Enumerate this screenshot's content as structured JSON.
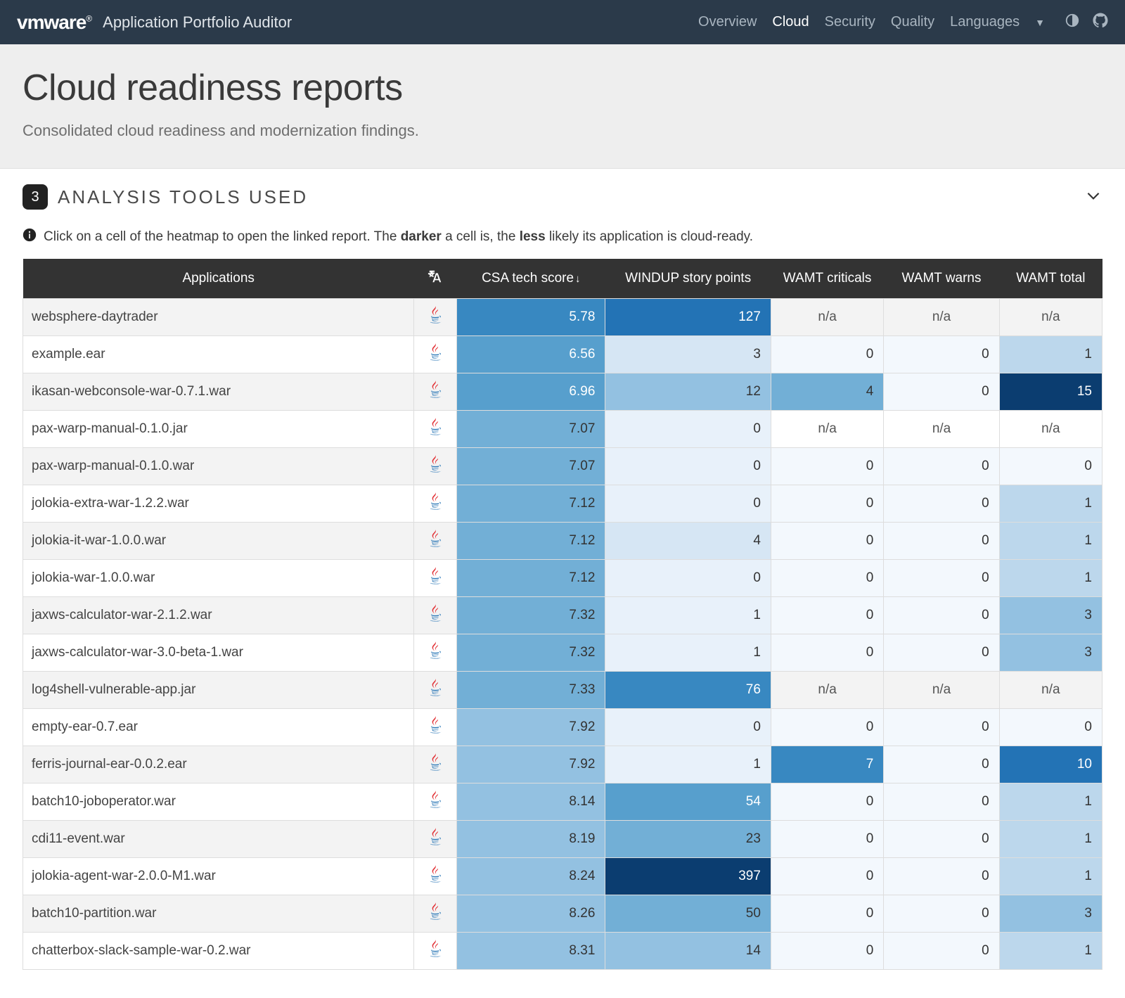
{
  "navbar": {
    "brand": "vmware",
    "app_title": "Application Portfolio Auditor",
    "links": {
      "overview": "Overview",
      "cloud": "Cloud",
      "security": "Security",
      "quality": "Quality",
      "languages": "Languages"
    }
  },
  "header": {
    "title": "Cloud readiness reports",
    "subtitle": "Consolidated cloud readiness and modernization findings."
  },
  "tools_section": {
    "count": "3",
    "label": "ANALYSIS TOOLS USED"
  },
  "info": {
    "pre": "Click on a cell of the heatmap to open the linked report. The ",
    "b1": "darker",
    "mid": " a cell is, the ",
    "b2": "less",
    "post": " likely its application is cloud-ready."
  },
  "columns": {
    "app": "Applications",
    "csa": "CSA tech score",
    "windup": "WINDUP story points",
    "wcrit": "WAMT criticals",
    "wwarn": "WAMT warns",
    "wtotal": "WAMT total"
  },
  "cell_colors": {
    "na": "#ffffff",
    "s0": "#f3f8fd",
    "s1": "#e8f1fa",
    "s2": "#d6e6f4",
    "s3": "#bcd7ec",
    "s4": "#93c1e1",
    "s5": "#72afd6",
    "s6": "#579fcd",
    "s7": "#3888c1",
    "s8": "#2373b5",
    "s9": "#155d9e",
    "s10": "#0b3d70"
  },
  "rows": [
    {
      "app": "websphere-daytrader",
      "csa": [
        "5.78",
        "s7",
        "l"
      ],
      "windup": [
        "127",
        "s8",
        "l"
      ],
      "wcrit": [
        "n/a",
        "na",
        "d"
      ],
      "wwarn": [
        "n/a",
        "na",
        "d"
      ],
      "wtotal": [
        "n/a",
        "na",
        "d"
      ]
    },
    {
      "app": "example.ear",
      "csa": [
        "6.56",
        "s6",
        "l"
      ],
      "windup": [
        "3",
        "s2",
        "d"
      ],
      "wcrit": [
        "0",
        "s0",
        "d"
      ],
      "wwarn": [
        "0",
        "s0",
        "d"
      ],
      "wtotal": [
        "1",
        "s3",
        "d"
      ]
    },
    {
      "app": "ikasan-webconsole-war-0.7.1.war",
      "csa": [
        "6.96",
        "s6",
        "l"
      ],
      "windup": [
        "12",
        "s4",
        "d"
      ],
      "wcrit": [
        "4",
        "s5",
        "d"
      ],
      "wwarn": [
        "0",
        "s0",
        "d"
      ],
      "wtotal": [
        "15",
        "s10",
        "l"
      ]
    },
    {
      "app": "pax-warp-manual-0.1.0.jar",
      "csa": [
        "7.07",
        "s5",
        "d"
      ],
      "windup": [
        "0",
        "s1",
        "d"
      ],
      "wcrit": [
        "n/a",
        "na",
        "d"
      ],
      "wwarn": [
        "n/a",
        "na",
        "d"
      ],
      "wtotal": [
        "n/a",
        "na",
        "d"
      ]
    },
    {
      "app": "pax-warp-manual-0.1.0.war",
      "csa": [
        "7.07",
        "s5",
        "d"
      ],
      "windup": [
        "0",
        "s1",
        "d"
      ],
      "wcrit": [
        "0",
        "s0",
        "d"
      ],
      "wwarn": [
        "0",
        "s0",
        "d"
      ],
      "wtotal": [
        "0",
        "s0",
        "d"
      ]
    },
    {
      "app": "jolokia-extra-war-1.2.2.war",
      "csa": [
        "7.12",
        "s5",
        "d"
      ],
      "windup": [
        "0",
        "s1",
        "d"
      ],
      "wcrit": [
        "0",
        "s0",
        "d"
      ],
      "wwarn": [
        "0",
        "s0",
        "d"
      ],
      "wtotal": [
        "1",
        "s3",
        "d"
      ]
    },
    {
      "app": "jolokia-it-war-1.0.0.war",
      "csa": [
        "7.12",
        "s5",
        "d"
      ],
      "windup": [
        "4",
        "s2",
        "d"
      ],
      "wcrit": [
        "0",
        "s0",
        "d"
      ],
      "wwarn": [
        "0",
        "s0",
        "d"
      ],
      "wtotal": [
        "1",
        "s3",
        "d"
      ]
    },
    {
      "app": "jolokia-war-1.0.0.war",
      "csa": [
        "7.12",
        "s5",
        "d"
      ],
      "windup": [
        "0",
        "s1",
        "d"
      ],
      "wcrit": [
        "0",
        "s0",
        "d"
      ],
      "wwarn": [
        "0",
        "s0",
        "d"
      ],
      "wtotal": [
        "1",
        "s3",
        "d"
      ]
    },
    {
      "app": "jaxws-calculator-war-2.1.2.war",
      "csa": [
        "7.32",
        "s5",
        "d"
      ],
      "windup": [
        "1",
        "s1",
        "d"
      ],
      "wcrit": [
        "0",
        "s0",
        "d"
      ],
      "wwarn": [
        "0",
        "s0",
        "d"
      ],
      "wtotal": [
        "3",
        "s4",
        "d"
      ]
    },
    {
      "app": "jaxws-calculator-war-3.0-beta-1.war",
      "csa": [
        "7.32",
        "s5",
        "d"
      ],
      "windup": [
        "1",
        "s1",
        "d"
      ],
      "wcrit": [
        "0",
        "s0",
        "d"
      ],
      "wwarn": [
        "0",
        "s0",
        "d"
      ],
      "wtotal": [
        "3",
        "s4",
        "d"
      ]
    },
    {
      "app": "log4shell-vulnerable-app.jar",
      "csa": [
        "7.33",
        "s5",
        "d"
      ],
      "windup": [
        "76",
        "s7",
        "l"
      ],
      "wcrit": [
        "n/a",
        "na",
        "d"
      ],
      "wwarn": [
        "n/a",
        "na",
        "d"
      ],
      "wtotal": [
        "n/a",
        "na",
        "d"
      ]
    },
    {
      "app": "empty-ear-0.7.ear",
      "csa": [
        "7.92",
        "s4",
        "d"
      ],
      "windup": [
        "0",
        "s1",
        "d"
      ],
      "wcrit": [
        "0",
        "s0",
        "d"
      ],
      "wwarn": [
        "0",
        "s0",
        "d"
      ],
      "wtotal": [
        "0",
        "s0",
        "d"
      ]
    },
    {
      "app": "ferris-journal-ear-0.0.2.ear",
      "csa": [
        "7.92",
        "s4",
        "d"
      ],
      "windup": [
        "1",
        "s1",
        "d"
      ],
      "wcrit": [
        "7",
        "s7",
        "l"
      ],
      "wwarn": [
        "0",
        "s0",
        "d"
      ],
      "wtotal": [
        "10",
        "s8",
        "l"
      ]
    },
    {
      "app": "batch10-joboperator.war",
      "csa": [
        "8.14",
        "s4",
        "d"
      ],
      "windup": [
        "54",
        "s6",
        "l"
      ],
      "wcrit": [
        "0",
        "s0",
        "d"
      ],
      "wwarn": [
        "0",
        "s0",
        "d"
      ],
      "wtotal": [
        "1",
        "s3",
        "d"
      ]
    },
    {
      "app": "cdi11-event.war",
      "csa": [
        "8.19",
        "s4",
        "d"
      ],
      "windup": [
        "23",
        "s5",
        "d"
      ],
      "wcrit": [
        "0",
        "s0",
        "d"
      ],
      "wwarn": [
        "0",
        "s0",
        "d"
      ],
      "wtotal": [
        "1",
        "s3",
        "d"
      ]
    },
    {
      "app": "jolokia-agent-war-2.0.0-M1.war",
      "csa": [
        "8.24",
        "s4",
        "d"
      ],
      "windup": [
        "397",
        "s10",
        "l"
      ],
      "wcrit": [
        "0",
        "s0",
        "d"
      ],
      "wwarn": [
        "0",
        "s0",
        "d"
      ],
      "wtotal": [
        "1",
        "s3",
        "d"
      ]
    },
    {
      "app": "batch10-partition.war",
      "csa": [
        "8.26",
        "s4",
        "d"
      ],
      "windup": [
        "50",
        "s5",
        "d"
      ],
      "wcrit": [
        "0",
        "s0",
        "d"
      ],
      "wwarn": [
        "0",
        "s0",
        "d"
      ],
      "wtotal": [
        "3",
        "s4",
        "d"
      ]
    },
    {
      "app": "chatterbox-slack-sample-war-0.2.war",
      "csa": [
        "8.31",
        "s4",
        "d"
      ],
      "windup": [
        "14",
        "s4",
        "d"
      ],
      "wcrit": [
        "0",
        "s0",
        "d"
      ],
      "wwarn": [
        "0",
        "s0",
        "d"
      ],
      "wtotal": [
        "1",
        "s3",
        "d"
      ]
    }
  ]
}
